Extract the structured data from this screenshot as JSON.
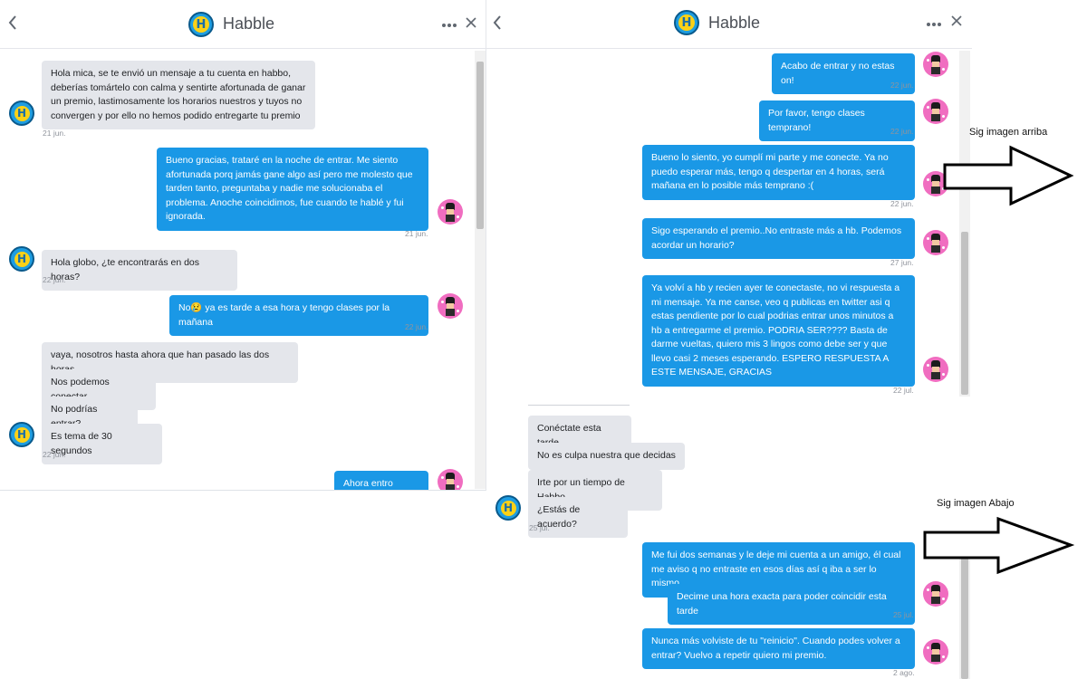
{
  "left_panel": {
    "title": "Habble",
    "back_icon": "chevron-left-icon",
    "more_icon": "more-horizontal-icon",
    "close_icon": "close-icon",
    "logo_letter": "H",
    "messages": [
      {
        "dir": "in",
        "text": "Hola mica, se te envió un mensaje a tu cuenta en habbo, deberías tomártelo con calma y sentirte afortunada de ganar un premio, lastimosamente los horarios nuestros y tuyos no convergen y por ello no hemos podido entregarte tu premio",
        "time": "21 jun."
      },
      {
        "dir": "out",
        "text": "Bueno gracias, trataré en la noche de entrar. Me siento afortunada porq jamás gane algo así pero me molesto que tarden tanto, preguntaba y nadie me solucionaba el problema. Anoche coincidimos, fue cuando te hablé y fui ignorada.",
        "time": "21 jun."
      },
      {
        "dir": "in",
        "text": "Hola globo, ¿te encontrarás en dos horas?",
        "time": "22 jun."
      },
      {
        "dir": "out",
        "text": "No😢 ya es tarde a esa hora y tengo clases por la mañana",
        "time": "22 jun."
      },
      {
        "dir": "in",
        "text": "vaya, nosotros hasta ahora que han pasado las dos horas"
      },
      {
        "dir": "in",
        "text": "Nos podemos conectar"
      },
      {
        "dir": "in",
        "text": "No podrías entrar?"
      },
      {
        "dir": "in",
        "text": "Es tema de 30 segundos",
        "time": "22 jun."
      },
      {
        "dir": "out",
        "text": "Ahora entro rapido"
      }
    ]
  },
  "right_panel": {
    "title": "Habble",
    "back_icon": "chevron-left-icon",
    "more_icon": "more-horizontal-icon",
    "close_icon": "close-icon",
    "logo_letter": "H",
    "messages": [
      {
        "dir": "out",
        "text": "Acabo de entrar y no estas on!",
        "time": "22 jun."
      },
      {
        "dir": "out",
        "text": "Por favor, tengo clases temprano!",
        "time": "22 jun."
      },
      {
        "dir": "out",
        "text": "Bueno lo siento, yo cumplí mi parte y me conecte. Ya no puedo esperar más, tengo q despertar en 4 horas, será mañana en lo posible más temprano :(",
        "time": "22 jun."
      },
      {
        "dir": "out",
        "text": "Sigo esperando el premio..No entraste más a hb. Podemos acordar un horario?",
        "time": "27 jun."
      },
      {
        "dir": "out",
        "text": "Ya volví a hb y recien ayer te conectaste, no vi respuesta a mi mensaje. Ya me canse, veo q publicas en twitter asi q estas pendiente por lo cual podrias entrar unos minutos a hb a entregarme el premio. PODRIA SER???? Basta de darme vueltas, quiero mis 3 lingos como debe ser y que llevo casi 2 meses esperando. ESPERO RESPUESTA A ESTE MENSAJE, GRACIAS",
        "time": "22 jul."
      },
      {
        "dir": "in",
        "text": "Conéctate esta tarde"
      },
      {
        "dir": "in",
        "text": "No es culpa nuestra que decidas"
      },
      {
        "dir": "in",
        "text": "Irte por un tiempo de Habbo"
      },
      {
        "dir": "in",
        "text": "¿Estás de acuerdo?",
        "time": "25 jul."
      },
      {
        "dir": "out",
        "text": "Me fui dos semanas y le deje mi cuenta a un amigo, él cual me aviso q no entraste en esos días así q iba a ser lo mismo."
      },
      {
        "dir": "out",
        "text": "Decime una hora exacta para poder coincidir esta tarde",
        "time": "25 jul."
      },
      {
        "dir": "out",
        "text": "Nunca más volviste de tu \"reinicio\". Cuando podes volver a entrar? Vuelvo a repetir quiero mi premio.",
        "time": "2 ago."
      }
    ]
  },
  "annotations": {
    "top_note": "Sig imagen arriba",
    "bottom_note": "Sig imagen Abajo",
    "arrow_icon": "right-arrow-icon"
  },
  "colors": {
    "outgoing_bubble": "#1a98e6",
    "incoming_bubble": "#e4e6eb",
    "logo_blue": "#1e9de1",
    "logo_yellow": "#fcd116"
  }
}
